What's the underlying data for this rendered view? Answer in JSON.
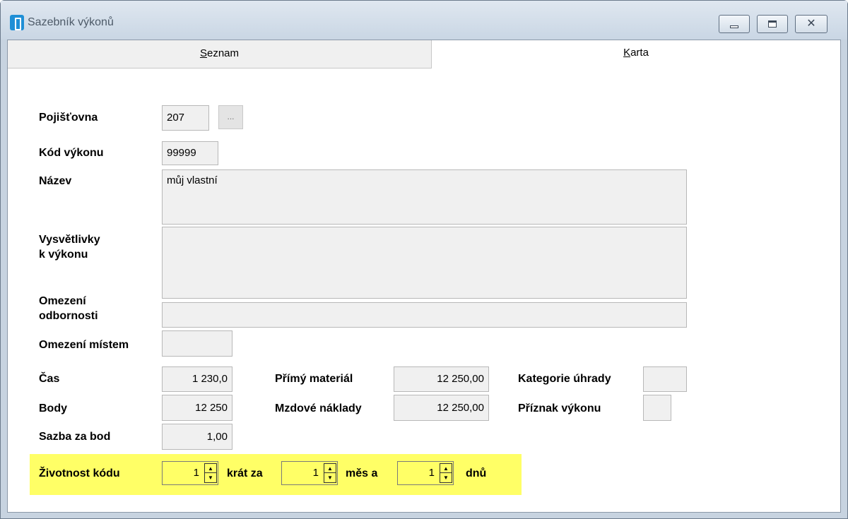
{
  "window": {
    "title": "Sazebník výkonů",
    "close_glyph": "✕"
  },
  "tabs": [
    {
      "label": "Seznam",
      "accel": "S",
      "rest": "eznam",
      "active": false
    },
    {
      "label": "Karta",
      "accel": "K",
      "rest": "arta",
      "active": true
    }
  ],
  "form": {
    "pojistovna": {
      "label": "Pojišťovna",
      "value": "207",
      "browse": "..."
    },
    "kod_vykonu": {
      "label": "Kód výkonu",
      "value": "99999"
    },
    "nazev": {
      "label": "Název",
      "value": "můj vlastní"
    },
    "vysvetlivky": {
      "label_line1": "Vysvětlivky",
      "label_line2": "k výkonu",
      "value": ""
    },
    "omezeni_odbornosti": {
      "label_line1": "Omezení",
      "label_line2": "odbornosti",
      "value": ""
    },
    "omezeni_mistem": {
      "label": "Omezení místem",
      "value": ""
    },
    "cas": {
      "label": "Čas",
      "value": "1 230,0"
    },
    "body": {
      "label": "Body",
      "value": "12 250"
    },
    "sazba": {
      "label": "Sazba za bod",
      "value": "1,00"
    },
    "primy_material": {
      "label": "Přímý materiál",
      "value": "12 250,00"
    },
    "mzdove_naklady": {
      "label": "Mzdové náklady",
      "value": "12 250,00"
    },
    "kategorie_uhrady": {
      "label": "Kategorie úhrady",
      "value": ""
    },
    "priznak_vykonu": {
      "label": "Příznak výkonu",
      "value": ""
    },
    "zivotnost": {
      "label": "Životnost kódu",
      "count": "1",
      "krat_za": "krát za",
      "mesice": "1",
      "mes_a": "měs a",
      "dny": "1",
      "dnu": "dnů"
    }
  },
  "colors": {
    "highlight": "#ffff66",
    "field_bg": "#f0f0f0",
    "titlebar": "#d6e0eb"
  },
  "icons": {
    "app": "app-icon",
    "minimize": "minimize-icon",
    "maximize": "maximize-icon",
    "close": "close-icon",
    "spin": "spin-arrows-icon"
  }
}
